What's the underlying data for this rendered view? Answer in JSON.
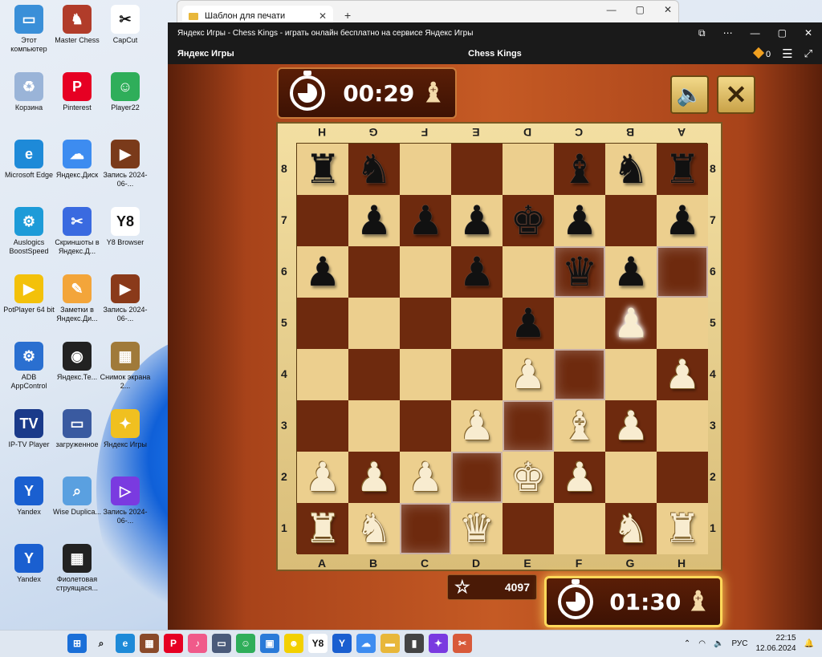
{
  "desktop": {
    "icons": [
      {
        "label": "Этот компьютер",
        "icon": "monitor-icon",
        "color": "#3a8fd8",
        "glyph": "▭"
      },
      {
        "label": "Master Chess",
        "icon": "master-chess-icon",
        "color": "#b13c2a",
        "glyph": "♞"
      },
      {
        "label": "CapCut",
        "icon": "capcut-icon",
        "color": "#ffffff",
        "glyph": "✂"
      },
      {
        "label": "Корзина",
        "icon": "recycle-bin-icon",
        "color": "#9ab4d8",
        "glyph": "♻"
      },
      {
        "label": "Pinterest",
        "icon": "pinterest-icon",
        "color": "#e60023",
        "glyph": "P"
      },
      {
        "label": "Player22",
        "icon": "player22-icon",
        "color": "#2fae5a",
        "glyph": "☺"
      },
      {
        "label": "Microsoft Edge",
        "icon": "edge-icon",
        "color": "#1e8ad8",
        "glyph": "e"
      },
      {
        "label": "Яндекс.Диск",
        "icon": "yandex-disk-icon",
        "color": "#3d8cf0",
        "glyph": "☁"
      },
      {
        "label": "Запись 2024-06-...",
        "icon": "video-file-icon",
        "color": "#7a3a1a",
        "glyph": "▶"
      },
      {
        "label": "Auslogics BoostSpeed",
        "icon": "auslogics-icon",
        "color": "#1d9bd8",
        "glyph": "⚙"
      },
      {
        "label": "Скриншоты в Яндекс.Д...",
        "icon": "screenshots-icon",
        "color": "#3a6ae0",
        "glyph": "✂"
      },
      {
        "label": "Y8 Browser",
        "icon": "y8-browser-icon",
        "color": "#ffffff",
        "glyph": "Y8"
      },
      {
        "label": "PotPlayer 64 bit",
        "icon": "potplayer-icon",
        "color": "#f3c10a",
        "glyph": "▶"
      },
      {
        "label": "Заметки в Яндекс.Ди...",
        "icon": "notes-icon",
        "color": "#f3a53a",
        "glyph": "✎"
      },
      {
        "label": "Запись 2024-06-...",
        "icon": "video-file-icon",
        "color": "#8a3a1a",
        "glyph": "▶"
      },
      {
        "label": "ADB AppControl",
        "icon": "adb-icon",
        "color": "#2a6fd0",
        "glyph": "⚙"
      },
      {
        "label": "Яндекс.Те...",
        "icon": "yandex-telemost-icon",
        "color": "#222222",
        "glyph": "◉"
      },
      {
        "label": "Снимок экрана 2...",
        "icon": "screenshot-file-icon",
        "color": "#a07a3a",
        "glyph": "▦"
      },
      {
        "label": "IP-TV Player",
        "icon": "iptv-icon",
        "color": "#1a3a8a",
        "glyph": "TV"
      },
      {
        "label": "загруженное",
        "icon": "image-file-icon",
        "color": "#3a5aa0",
        "glyph": "▭"
      },
      {
        "label": "Яндекс Игры",
        "icon": "yandex-games-icon",
        "color": "#f0c020",
        "glyph": "✦"
      },
      {
        "label": "Yandex",
        "icon": "yandex-browser-icon",
        "color": "#1a5fd0",
        "glyph": "Y"
      },
      {
        "label": "Wise Duplica...",
        "icon": "wise-duplicate-icon",
        "color": "#5aa0e0",
        "glyph": "⌕"
      },
      {
        "label": "Запись 2024-06-...",
        "icon": "mp4-file-icon",
        "color": "#7a3ae0",
        "glyph": "▷"
      },
      {
        "label": "Yandex",
        "icon": "yandex-browser-icon",
        "color": "#1a5fd0",
        "glyph": "Y"
      },
      {
        "label": "Фиолетовая струящася...",
        "icon": "video-file-icon",
        "color": "#222222",
        "glyph": "▦"
      }
    ]
  },
  "background_window": {
    "tab_title": "Шаблон для печати",
    "close": "✕",
    "new_tab": "+",
    "controls": [
      "—",
      "▢",
      "✕"
    ]
  },
  "game_window": {
    "title": "Яндекс Игры - Chess Kings - играть онлайн бесплатно на сервисе Яндекс Игры",
    "win_controls": [
      "⧉",
      "⋯",
      "—",
      "▢",
      "✕"
    ],
    "brand": "Яндекс Игры",
    "game_name": "Chess Kings",
    "coins": "0",
    "menu": "☰",
    "expand": "⤢"
  },
  "game": {
    "opponent_timer": "00:29",
    "player_timer": "01:30",
    "timer_piece_glyph": "♝",
    "sound_glyph": "🔈",
    "close_glyph": "✕",
    "rating": "4097",
    "star_glyph": "☆",
    "files": [
      "A",
      "B",
      "C",
      "D",
      "E",
      "F",
      "G",
      "H"
    ],
    "ranks": [
      "8",
      "7",
      "6",
      "5",
      "4",
      "3",
      "2",
      "1"
    ],
    "board": [
      [
        "bR",
        "bN",
        "",
        "",
        "",
        "bB",
        "bN",
        "bR"
      ],
      [
        "",
        "bP",
        "bP",
        "bP",
        "bK",
        "bP",
        "",
        "bP"
      ],
      [
        "bP",
        "",
        "",
        "bP",
        "",
        "bQ",
        "bP",
        ""
      ],
      [
        "",
        "",
        "",
        "",
        "bP",
        "",
        "wP",
        ""
      ],
      [
        "",
        "",
        "",
        "",
        "wP",
        "",
        "",
        "wP"
      ],
      [
        "",
        "",
        "",
        "wP",
        "",
        "wB",
        "wP",
        ""
      ],
      [
        "wP",
        "wP",
        "wP",
        "",
        "wK",
        "wP",
        "",
        ""
      ],
      [
        "wR",
        "wN",
        "",
        "wQ",
        "",
        "",
        "wN",
        "wR"
      ]
    ],
    "highlights": [
      "f6",
      "h6",
      "f4",
      "e3",
      "d2",
      "c1"
    ],
    "glow": [
      "g5"
    ],
    "piece_glyphs": {
      "K": "♚",
      "Q": "♛",
      "R": "♜",
      "B": "♝",
      "N": "♞",
      "P": "♟"
    }
  },
  "taskbar": {
    "apps": [
      {
        "name": "start-button",
        "glyph": "⊞",
        "color": "#1a6fd8"
      },
      {
        "name": "search-icon",
        "glyph": "⌕",
        "color": "#333333"
      },
      {
        "name": "edge-icon",
        "glyph": "e",
        "color": "#1e8ad8"
      },
      {
        "name": "video-app-icon",
        "glyph": "▦",
        "color": "#8a4a2a"
      },
      {
        "name": "pinterest-icon",
        "glyph": "P",
        "color": "#e60023"
      },
      {
        "name": "music-icon",
        "glyph": "♪",
        "color": "#f05a8a"
      },
      {
        "name": "screenshot-app-icon",
        "glyph": "▭",
        "color": "#4a5a7a"
      },
      {
        "name": "player22-icon",
        "glyph": "☺",
        "color": "#2fae5a"
      },
      {
        "name": "save-icon",
        "glyph": "▣",
        "color": "#2a7ad8"
      },
      {
        "name": "snapchat-icon",
        "glyph": "☻",
        "color": "#f3d000"
      },
      {
        "name": "y8-icon",
        "glyph": "Y8",
        "color": "#ffffff"
      },
      {
        "name": "yandex-icon",
        "glyph": "Y",
        "color": "#1a5fd0"
      },
      {
        "name": "yandex-disk-icon",
        "glyph": "☁",
        "color": "#3d8cf0"
      },
      {
        "name": "explorer-icon",
        "glyph": "▬",
        "color": "#e8b73a"
      },
      {
        "name": "bucket-icon",
        "glyph": "▮",
        "color": "#444444"
      },
      {
        "name": "yandex-games-icon",
        "glyph": "✦",
        "color": "#7a3ae0"
      },
      {
        "name": "snipping-icon",
        "glyph": "✂",
        "color": "#d85a3a"
      }
    ],
    "tray_chevron": "⌃",
    "language": "РУС",
    "time": "22:15",
    "date": "12.06.2024"
  }
}
